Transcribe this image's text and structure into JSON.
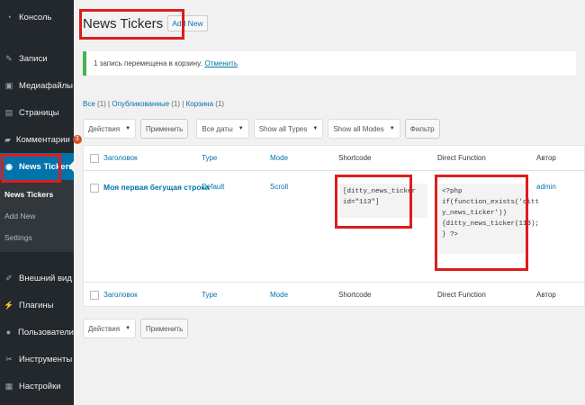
{
  "sidebar": {
    "items": [
      {
        "label": "Консоль",
        "icon": "dashboard-icon"
      },
      {
        "label": "Записи",
        "icon": "pin-icon"
      },
      {
        "label": "Медиафайлы",
        "icon": "media-icon"
      },
      {
        "label": "Страницы",
        "icon": "pages-icon"
      },
      {
        "label": "Комментарии",
        "icon": "comments-icon",
        "badge": "3"
      },
      {
        "label": "News Tickers",
        "icon": "ticker-icon"
      },
      {
        "label": "Внешний вид",
        "icon": "appearance-icon"
      },
      {
        "label": "Плагины",
        "icon": "plugins-icon"
      },
      {
        "label": "Пользователи",
        "icon": "users-icon"
      },
      {
        "label": "Инструменты",
        "icon": "tools-icon"
      },
      {
        "label": "Настройки",
        "icon": "settings-icon"
      }
    ],
    "submenu": [
      "News Tickers",
      "Add New",
      "Settings"
    ]
  },
  "header": {
    "title": "News Tickers",
    "add_new": "Add New"
  },
  "notice": {
    "text": "1 запись перемещена в корзину.",
    "link": "Отменить"
  },
  "filters": {
    "all": "Все",
    "all_count": "(1)",
    "published": "Опубликованные",
    "published_count": "(1)",
    "trash": "Корзина",
    "trash_count": "(1)"
  },
  "tablenav": {
    "bulk": "Действия",
    "apply": "Применить",
    "dates": "Все даты",
    "types": "Show all Types",
    "modes": "Show all Modes",
    "filter": "Фильтр"
  },
  "table": {
    "columns": [
      "Заголовок",
      "Type",
      "Mode",
      "Shortcode",
      "Direct Function",
      "Автор"
    ],
    "row": {
      "title": "Моя первая бегущая строка",
      "type": "Default",
      "mode": "Scroll",
      "shortcode": "[ditty_news_ticker\nid=\"113\"]",
      "function": "<?php\nif(function_exists('ditt\ny_news_ticker'))\n{ditty_news_ticker(113);\n} ?>",
      "author": "admin"
    }
  },
  "colors": {
    "sidebar_bg": "#23282d",
    "active": "#0073aa",
    "highlight": "#dd1c1c",
    "notice": "#46b450"
  }
}
